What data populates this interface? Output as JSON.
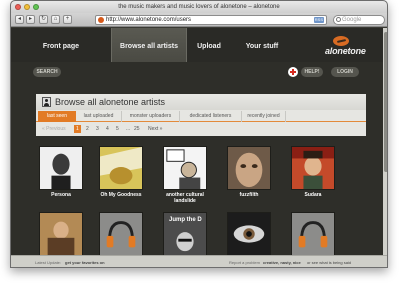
{
  "window": {
    "title": "the music makers and music lovers of alonetone – alonetone"
  },
  "toolbar": {
    "url": "http://www.alonetone.com/users",
    "rss": "RSS",
    "search_placeholder": "Google"
  },
  "nav": {
    "items": [
      {
        "label": "Front page"
      },
      {
        "label": "Browse all artists"
      },
      {
        "label": "Upload"
      },
      {
        "label": "Your stuff"
      }
    ],
    "logo": "alonetone"
  },
  "subbar": {
    "search": "SEARCH",
    "help": "HELP!",
    "login": "LOGIN"
  },
  "panel": {
    "title": "Browse all alonetone artists",
    "tabs": [
      "last seen",
      "last uploaded",
      "monster uploaders",
      "dedicated listeners",
      "recently joined"
    ],
    "pager": {
      "prev": "« Previous",
      "pages": [
        "1",
        "2",
        "3",
        "4",
        "5",
        "...",
        "25"
      ],
      "next": "Next »"
    }
  },
  "artists": [
    {
      "name": "Persona"
    },
    {
      "name": "Oh My Goodness"
    },
    {
      "name": "another cultural landslide"
    },
    {
      "name": "fuzzfilth"
    },
    {
      "name": "Sudara"
    },
    {
      "name": ""
    },
    {
      "name": ""
    },
    {
      "name": ""
    },
    {
      "name": ""
    },
    {
      "name": ""
    }
  ],
  "artist_thumb_text": {
    "third": "Jump the D"
  },
  "status": {
    "latest_label": "Latest Update:",
    "latest_text": "get your favorites on",
    "report_text": "Report a problem",
    "report_bold": "creative, nasty, nice",
    "report_tail": "or see what is being said"
  },
  "colors": {
    "accent": "#e27b25",
    "background": "#2e2e29",
    "panel": "#e6e6e2"
  }
}
